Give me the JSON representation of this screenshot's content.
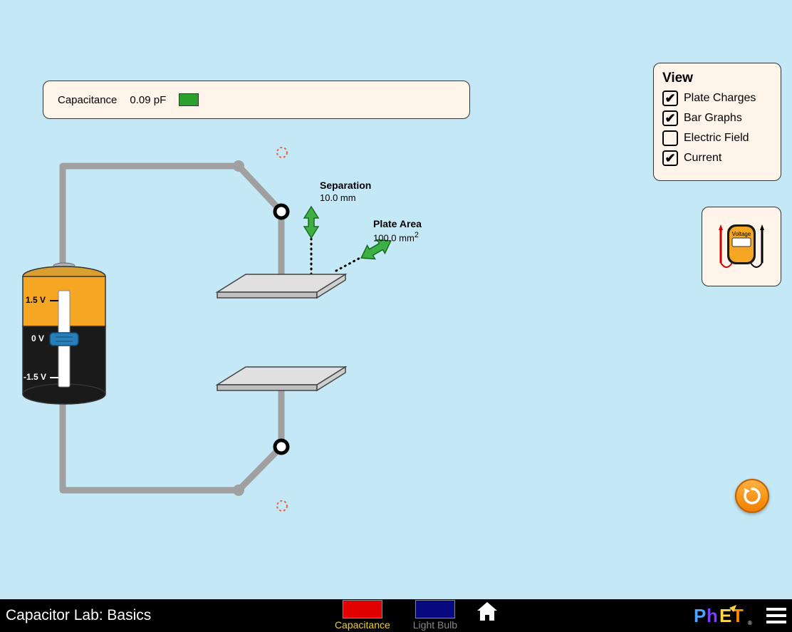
{
  "readout": {
    "label": "Capacitance",
    "value": "0.09 pF"
  },
  "view": {
    "title": "View",
    "options": [
      {
        "label": "Plate Charges",
        "checked": true
      },
      {
        "label": "Bar Graphs",
        "checked": true
      },
      {
        "label": "Electric Field",
        "checked": false
      },
      {
        "label": "Current",
        "checked": true
      }
    ]
  },
  "separation": {
    "label": "Separation",
    "value": "10.0  mm"
  },
  "plateArea": {
    "label": "Plate Area",
    "value": "100.0  mm",
    "unit_sup": "2"
  },
  "battery": {
    "ticks": {
      "top": "1.5 V",
      "mid": "0 V",
      "bot": "-1.5 V"
    }
  },
  "voltmeter": {
    "label": "Voltage"
  },
  "tabs": {
    "capacitance": "Capacitance",
    "lightbulb": "Light Bulb"
  },
  "footer": {
    "title": "Capacitor Lab: Basics",
    "brand": "PhET",
    "reg": "®"
  }
}
